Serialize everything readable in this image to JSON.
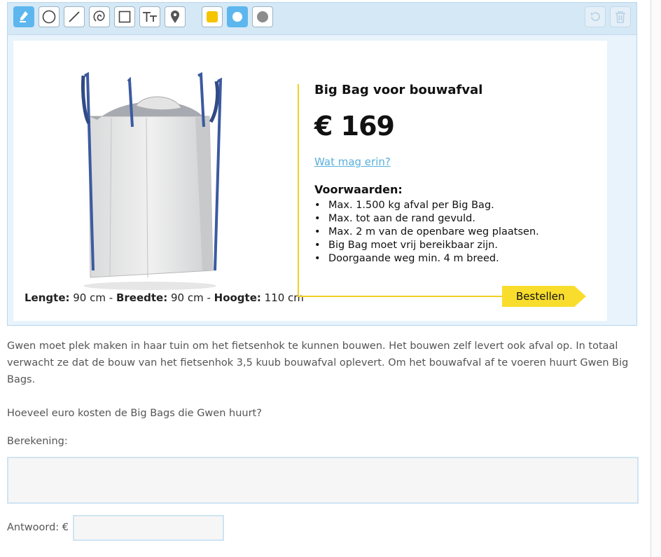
{
  "toolbar": {
    "tools": [
      {
        "name": "marker-icon",
        "active": true
      },
      {
        "name": "circle-icon",
        "active": false
      },
      {
        "name": "line-icon",
        "active": false
      },
      {
        "name": "freehand-icon",
        "active": false
      },
      {
        "name": "square-icon",
        "active": false
      },
      {
        "name": "text-icon",
        "active": false
      },
      {
        "name": "pin-icon",
        "active": false
      }
    ],
    "colors": {
      "yellow": "#f5c400",
      "blue": "#5db7ee",
      "gray": "#8c8c8c"
    },
    "undo_icon": "undo-icon",
    "trash_icon": "trash-icon"
  },
  "card": {
    "dims": {
      "length_label": "Lengte:",
      "length_value": " 90 cm - ",
      "width_label": "Breedte:",
      "width_value": " 90 cm - ",
      "height_label": "Hoogte:",
      "height_value": " 110 cm"
    },
    "title": "Big Bag voor bouwafval",
    "price": "€ 169",
    "link": "Wat mag erin?",
    "conditions_title": "Voorwaarden:",
    "conditions": [
      "Max. 1.500 kg afval per Big Bag.",
      "Max. tot aan de rand gevuld.",
      "Max. 2 m van de openbare weg plaatsen.",
      "Big Bag moet vrij bereikbaar zijn.",
      "Doorgaande weg min. 4 m breed."
    ],
    "order_button": "Bestellen",
    "accent_color": "#f9dd2c"
  },
  "exercise": {
    "paragraph": "Gwen moet plek maken in haar tuin om het fietsenhok te kunnen bouwen. Het bouwen zelf levert ook afval op. In totaal verwacht ze dat de bouw van het fietsenhok 3,5 kuub bouwafval oplevert. Om het bouwafval af te voeren huurt Gwen Big Bags.",
    "question": "Hoeveel euro kosten de Big Bags die Gwen huurt?",
    "calc_label": "Berekening:",
    "calc_value": "",
    "answer_label": "Antwoord: €",
    "answer_value": ""
  }
}
